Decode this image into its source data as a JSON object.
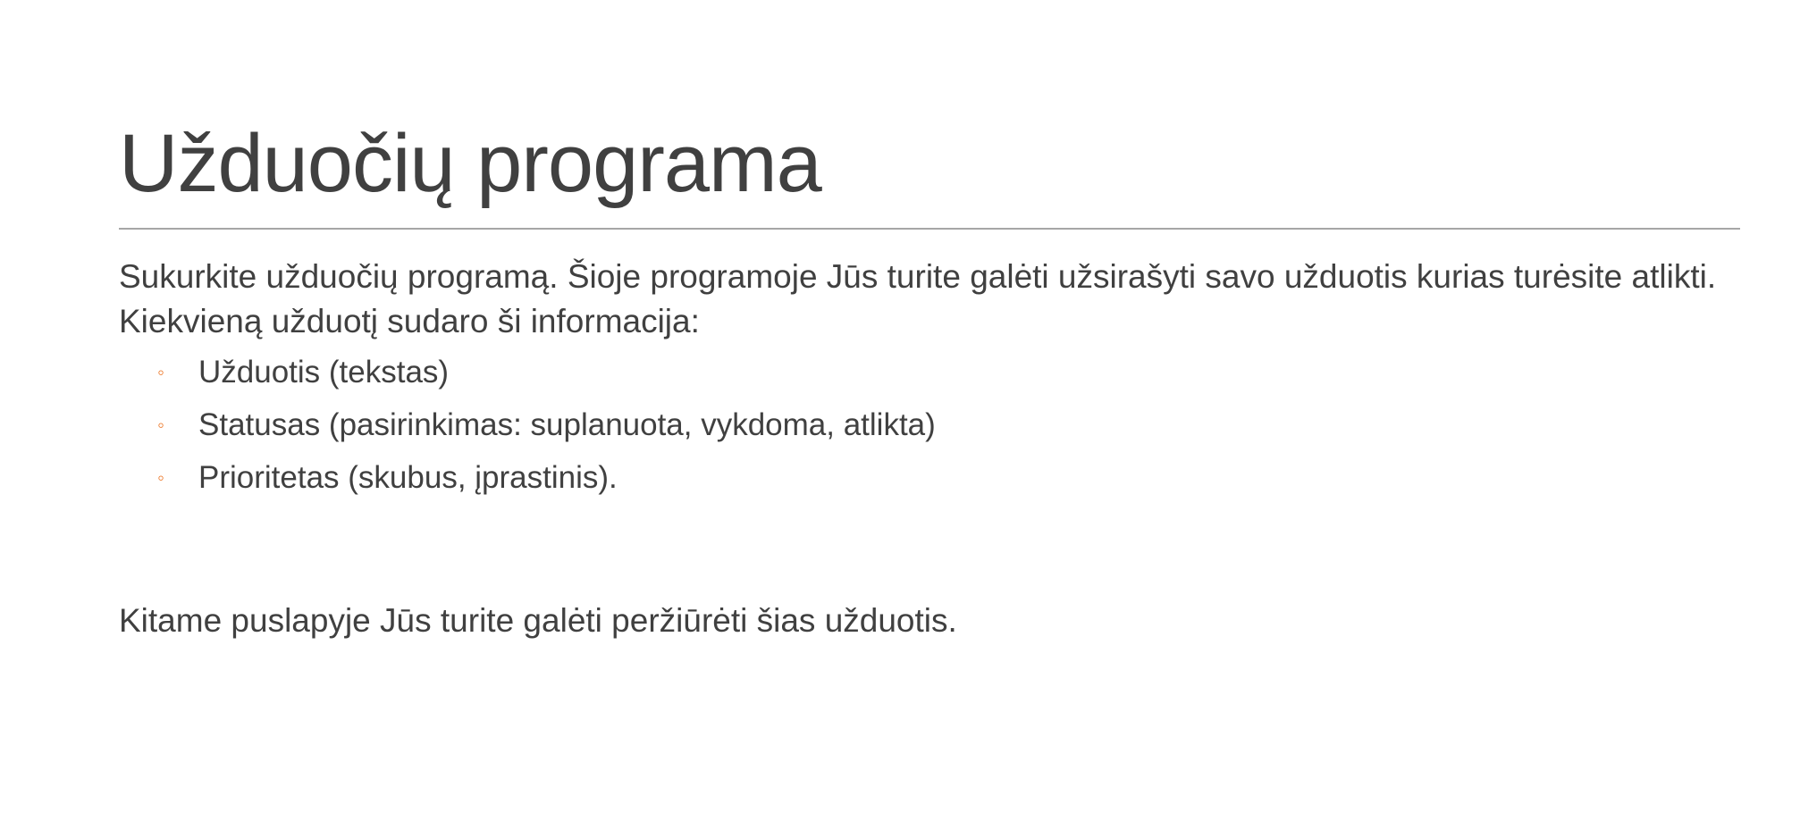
{
  "slide": {
    "title": "Užduočių programa",
    "intro": "Sukurkite užduočių programą. Šioje programoje Jūs turite galėti užsirašyti savo užduotis kurias turėsite atlikti. Kiekvieną užduotį sudaro ši informacija:",
    "bullet_marker": "◦",
    "bullets": [
      "Užduotis (tekstas)",
      "Statusas (pasirinkimas: suplanuota, vykdoma, atlikta)",
      "Prioritetas (skubus, įprastinis)."
    ],
    "closing": "Kitame puslapyje Jūs turite galėti peržiūrėti šias užduotis.",
    "colors": {
      "text": "#404040",
      "bullet_accent": "#ed7d31",
      "divider": "#a6a6a6",
      "background": "#ffffff"
    }
  }
}
